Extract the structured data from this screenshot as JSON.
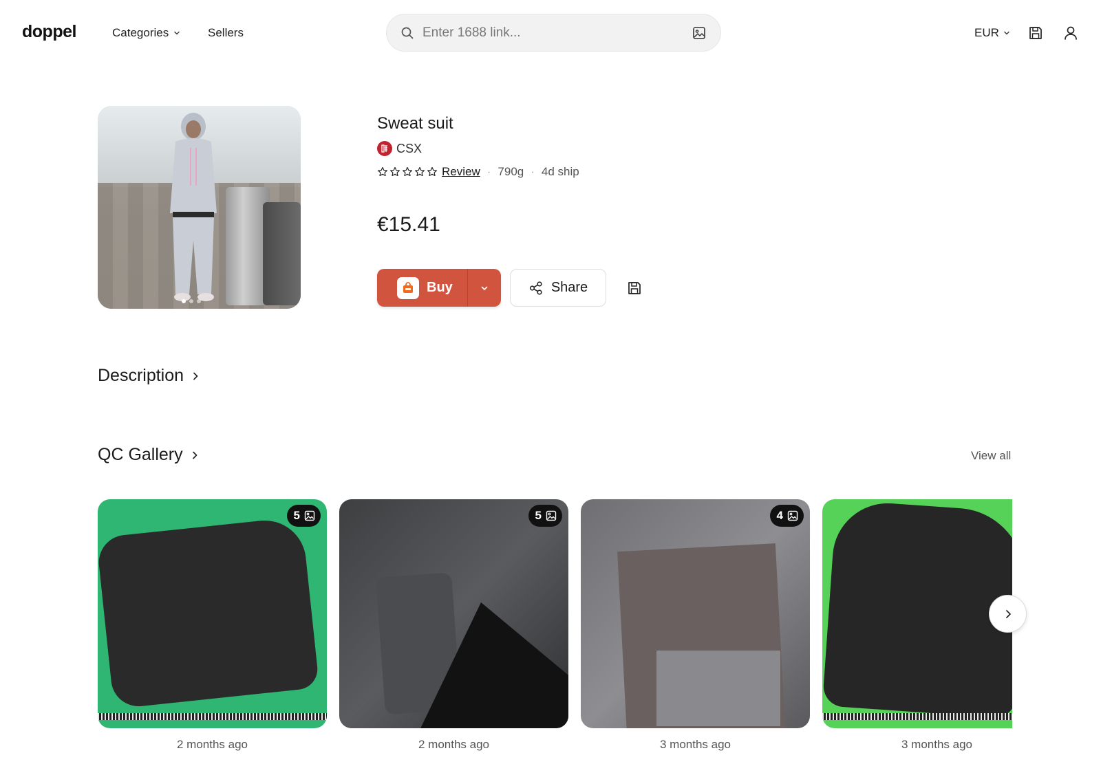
{
  "header": {
    "logo": "doppel",
    "nav": [
      {
        "label": "Categories",
        "has_dropdown": true
      },
      {
        "label": "Sellers",
        "has_dropdown": false
      }
    ],
    "search": {
      "placeholder": "Enter 1688 link...",
      "value": "",
      "left_icon": "search-icon",
      "right_icon": "image-search-icon"
    },
    "currency": "EUR",
    "icons": [
      "bookmark-icon",
      "user-icon"
    ]
  },
  "product": {
    "title": "Sweat suit",
    "seller": {
      "name": "CSX",
      "logo_icon": "seller-logo-icon"
    },
    "rating": {
      "stars_filled": 0,
      "stars_total": 5
    },
    "review_label": "Review",
    "weight": "790g",
    "shipping": "4d ship",
    "price": "€15.41",
    "image_carousel": {
      "total": 3,
      "active_index": 0
    },
    "actions": {
      "buy_label": "Buy",
      "share_label": "Share"
    }
  },
  "sections": {
    "description_title": "Description",
    "qc_title": "QC Gallery",
    "view_all": "View all"
  },
  "qc_gallery": [
    {
      "count": "5",
      "time": "2 months ago"
    },
    {
      "count": "5",
      "time": "2 months ago"
    },
    {
      "count": "4",
      "time": "3 months ago"
    },
    {
      "count": "",
      "time": "3 months ago"
    }
  ],
  "colors": {
    "buy_button": "#d1543e",
    "text_primary": "#1a1a1a",
    "text_muted": "#555555",
    "seller_logo": "#c0242f"
  }
}
